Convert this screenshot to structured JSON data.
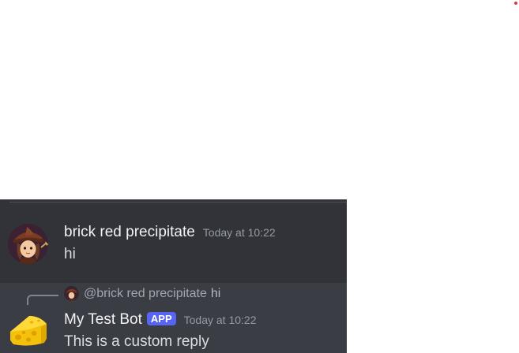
{
  "colors": {
    "chat_background": "#313338",
    "hover_background": "#3b3d44",
    "app_badge": "#5865f2",
    "username": "#f2f3f5",
    "timestamp": "#949ba4",
    "corner_dot": "#d93a3a"
  },
  "messages": [
    {
      "avatar_icon": "witch-character-avatar-icon",
      "username": "brick red precipitate",
      "timestamp": "Today at 10:22",
      "content": "hi"
    },
    {
      "avatar_icon": "cheese-avatar-icon",
      "reply_to": {
        "avatar_icon": "witch-character-avatar-icon",
        "username": "@brick red precipitate",
        "content": "hi"
      },
      "username": "My Test Bot",
      "badge": "APP",
      "timestamp": "Today at 10:22",
      "content": "This is a custom reply"
    }
  ]
}
